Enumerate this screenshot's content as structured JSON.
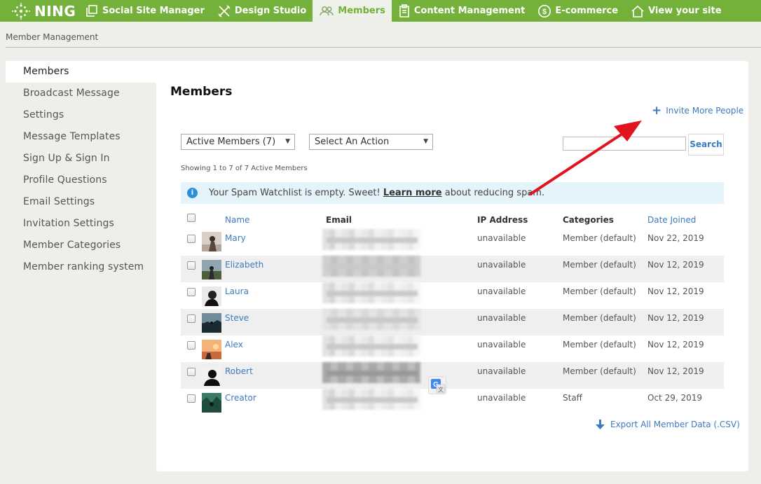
{
  "topnav": {
    "brand": "NING",
    "items": [
      {
        "label": "Social Site Manager",
        "icon": "copy-icon"
      },
      {
        "label": "Design Studio",
        "icon": "design-icon"
      },
      {
        "label": "Members",
        "icon": "people-icon",
        "active": true
      },
      {
        "label": "Content Management",
        "icon": "clipboard-icon"
      },
      {
        "label": "E-commerce",
        "icon": "dollar-icon"
      },
      {
        "label": "View your site",
        "icon": "home-icon"
      }
    ]
  },
  "breadcrumb": "Member Management",
  "sidebar": {
    "items": [
      {
        "label": "Members",
        "active": true
      },
      {
        "label": "Broadcast Message"
      },
      {
        "label": "Settings"
      },
      {
        "label": "Message Templates"
      },
      {
        "label": "Sign Up & Sign In"
      },
      {
        "label": "Profile Questions"
      },
      {
        "label": "Email Settings"
      },
      {
        "label": "Invitation Settings"
      },
      {
        "label": "Member Categories"
      },
      {
        "label": "Member ranking system"
      }
    ]
  },
  "main": {
    "title": "Members",
    "invite_label": "Invite More People",
    "filter_select": "Active Members (7)",
    "action_select": "Select An Action",
    "search_button": "Search",
    "search_value": "",
    "showing": "Showing 1 to 7 of 7 Active Members",
    "spam": {
      "before": "Your Spam Watchlist is empty. Sweet!",
      "link": "Learn more",
      "after": "about reducing spam."
    },
    "columns": {
      "name": "Name",
      "email": "Email",
      "ip": "IP Address",
      "categories": "Categories",
      "date_joined": "Date Joined"
    },
    "rows": [
      {
        "name": "Mary",
        "ip": "unavailable",
        "category": "Member (default)",
        "date": "Nov 22, 2019"
      },
      {
        "name": "Elizabeth",
        "ip": "unavailable",
        "category": "Member (default)",
        "date": "Nov 12, 2019"
      },
      {
        "name": "Laura",
        "ip": "unavailable",
        "category": "Member (default)",
        "date": "Nov 12, 2019"
      },
      {
        "name": "Steve",
        "ip": "unavailable",
        "category": "Member (default)",
        "date": "Nov 12, 2019"
      },
      {
        "name": "Alex",
        "ip": "unavailable",
        "category": "Member (default)",
        "date": "Nov 12, 2019"
      },
      {
        "name": "Robert",
        "ip": "unavailable",
        "category": "Member (default)",
        "date": "Nov 12, 2019"
      },
      {
        "name": "Creator",
        "ip": "unavailable",
        "category": "Staff",
        "date": "Oct 29, 2019"
      }
    ],
    "export_label": "Export All Member Data (.CSV)"
  },
  "colors": {
    "brand_green": "#74b13b",
    "link_blue": "#3b7bbf",
    "annotation_red": "#e0141e",
    "info_bg": "#e5f4fb"
  }
}
